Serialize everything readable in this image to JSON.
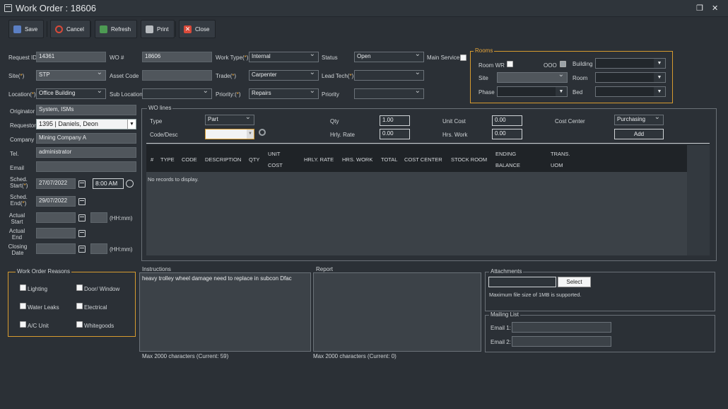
{
  "window": {
    "title": "Work Order : 18606"
  },
  "toolbar": {
    "save": "Save",
    "cancel": "Cancel",
    "refresh": "Refresh",
    "print": "Print",
    "close": "Close"
  },
  "form": {
    "request_id_label": "Request ID",
    "request_id": "14361",
    "wo_label": "WO #",
    "wo": "18606",
    "work_type_label": "Work Type",
    "work_type": "Internal",
    "status_label": "Status",
    "status": "Open",
    "main_service_label": "Main Service",
    "site_label": "Site",
    "site": "STP",
    "asset_code_label": "Asset Code",
    "trade_label": "Trade",
    "trade": "Carpenter",
    "lead_tech_label": "Lead Tech",
    "location_label": "Location",
    "location": "Office Building",
    "sub_location_label": "Sub Location",
    "priority_label": "Priority:",
    "priority": "Repairs",
    "priority2_label": "Priority",
    "originator_label": "Originator",
    "originator": "System, ISMs",
    "requestor_label": "Requestor",
    "requestor": "1395 | Daniels, Deon",
    "company_label": "Company",
    "company": "Mining Company A",
    "tel_label": "Tel.",
    "tel": "administrator",
    "email_label": "Email",
    "sched_start_label1": "Sched.",
    "sched_start_label2": "Start",
    "sched_start_date": "27/07/2022",
    "sched_start_time": "8:00 AM",
    "sched_end_label1": "Sched.",
    "sched_end_label2": "End",
    "sched_end_date": "29/07/2022",
    "actual_start_label1": "Actual",
    "actual_start_label2": "Start",
    "hhmm": "(HH:mm)",
    "actual_end_label1": "Actual",
    "actual_end_label2": "End",
    "closing_label1": "Closing",
    "closing_label2": "Date"
  },
  "rooms": {
    "title": "Rooms",
    "room_wr": "Room WR",
    "ooo": "OOO",
    "building": "Building",
    "site": "Site",
    "room": "Room",
    "phase": "Phase",
    "bed": "Bed"
  },
  "wo_lines": {
    "title": "WO lines",
    "type_label": "Type",
    "type": "Part",
    "qty_label": "Qty",
    "qty": "1.00",
    "unit_cost_label": "Unit Cost",
    "unit_cost": "0.00",
    "cost_center_label": "Cost Center",
    "cost_center": "Purchasing",
    "code_label": "Code/Desc",
    "hrly_rate_label": "Hrly. Rate",
    "hrly_rate": "0.00",
    "hrs_work_label": "Hrs. Work",
    "hrs_work": "0.00",
    "add": "Add",
    "columns": [
      "#",
      "TYPE",
      "CODE",
      "DESCRIPTION",
      "QTY",
      "UNIT",
      "COST",
      "HRLY. RATE",
      "HRS. WORK",
      "TOTAL",
      "COST CENTER",
      "STOCK ROOM",
      "ENDING",
      "BALANCE",
      "TRANS.",
      "UOM"
    ],
    "empty": "No records to display."
  },
  "reasons": {
    "title": "Work Order Reasons",
    "items": [
      "Lighting",
      "Door/ Window",
      "Water Leaks",
      "Electrical",
      "A/C Unit",
      "Whitegoods"
    ]
  },
  "instructions": {
    "label": "Instructions",
    "text": "heavy trolley wheel  damage need to replace in subcon Dfac",
    "counter": "Max 2000 characters (Current: 59)"
  },
  "report": {
    "label": "Report",
    "counter": "Max 2000 characters (Current: 0)"
  },
  "attachments": {
    "title": "Attachments",
    "select": "Select",
    "note": "Maximum file size of 1MB is supported."
  },
  "mailing": {
    "title": "Mailing List",
    "email1": "Email 1:",
    "email2": "Email 2:"
  },
  "colors": {
    "accent": "#d79b2f",
    "required": "#e7a53a"
  }
}
